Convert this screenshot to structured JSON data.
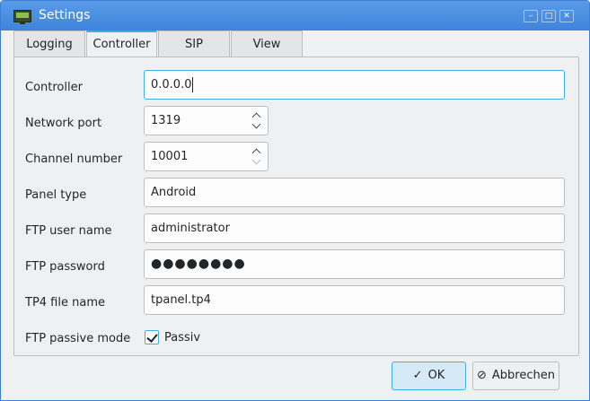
{
  "window": {
    "title": "Settings",
    "controls": {
      "minimize": "–",
      "maximize": "□",
      "close": "✕"
    }
  },
  "tabs": [
    {
      "label": "Logging",
      "active": false
    },
    {
      "label": "Controller",
      "active": true
    },
    {
      "label": "SIP",
      "active": false
    },
    {
      "label": "View",
      "active": false
    }
  ],
  "form": {
    "controller": {
      "label": "Controller",
      "value": "0.0.0.0"
    },
    "network_port": {
      "label": "Network port",
      "value": "1319"
    },
    "channel_number": {
      "label": "Channel number",
      "value": "10001"
    },
    "panel_type": {
      "label": "Panel type",
      "value": "Android"
    },
    "ftp_user": {
      "label": "FTP user name",
      "value": "administrator"
    },
    "ftp_password": {
      "label": "FTP password",
      "value": "●●●●●●●●"
    },
    "tp4_file": {
      "label": "TP4 file name",
      "value": "tpanel.tp4"
    },
    "ftp_passive": {
      "label": "FTP passive mode",
      "checkbox_label": "Passiv",
      "checked": true
    }
  },
  "buttons": {
    "ok": {
      "label": "OK",
      "icon": "check-icon"
    },
    "cancel": {
      "label": "Abbrechen",
      "icon": "cancel-icon"
    }
  },
  "colors": {
    "titlebar": "#3f84dc",
    "accent": "#3daee9",
    "window_bg": "#eff0f1"
  }
}
